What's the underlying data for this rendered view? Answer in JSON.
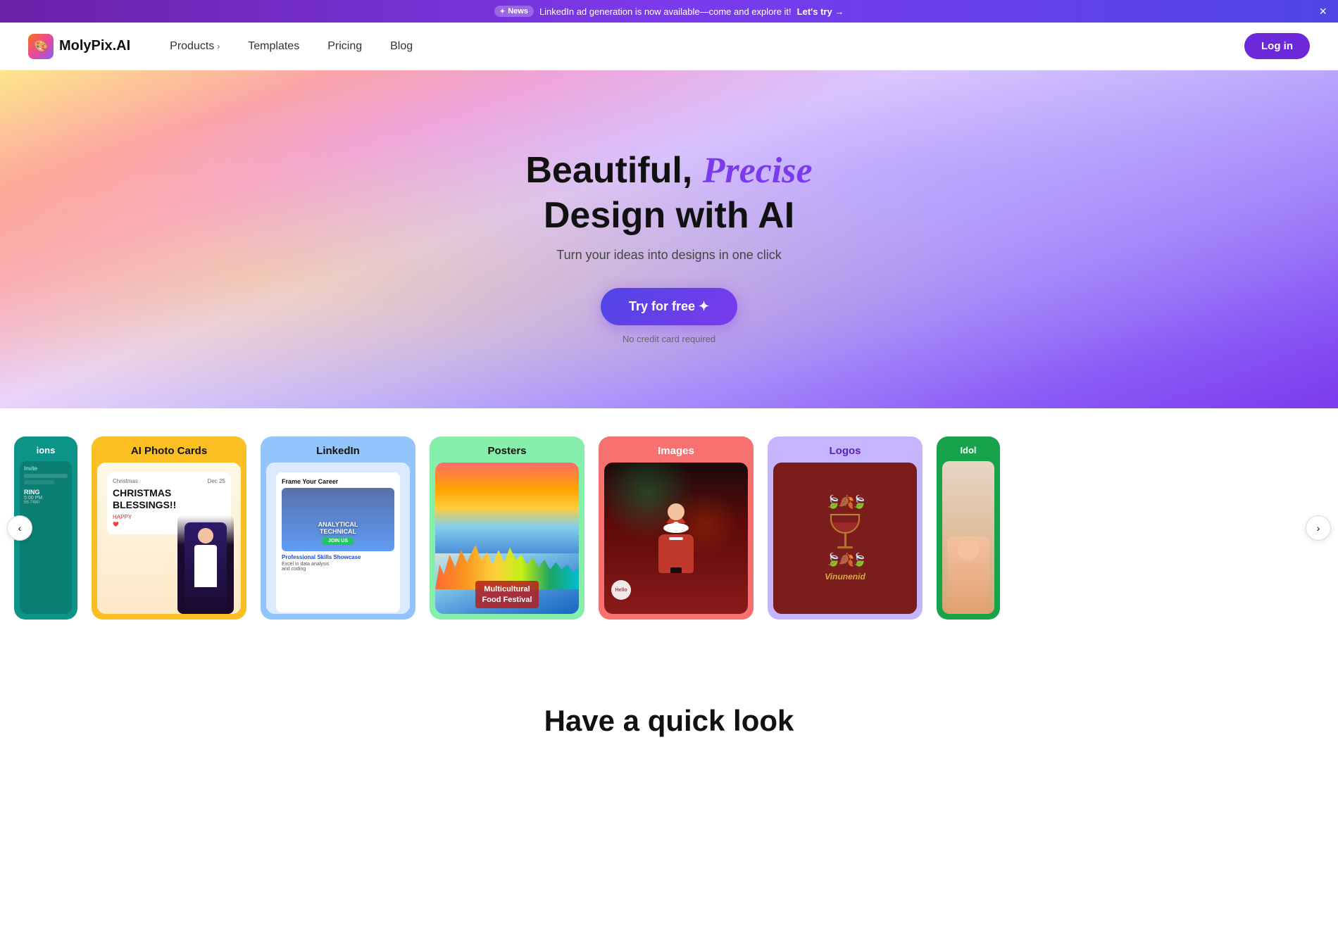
{
  "announcement": {
    "badge": "News",
    "message": "LinkedIn ad generation is now available—come and explore it!",
    "link_text": "Let's try →",
    "close_label": "×"
  },
  "header": {
    "logo_text": "MolyPix.AI",
    "logo_icon": "🎨",
    "nav": [
      {
        "label": "Products",
        "has_arrow": true
      },
      {
        "label": "Templates",
        "has_arrow": false
      },
      {
        "label": "Pricing",
        "has_arrow": false
      },
      {
        "label": "Blog",
        "has_arrow": false
      }
    ],
    "login_label": "Log in"
  },
  "hero": {
    "title_line1_plain": "Beautiful, ",
    "title_line1_italic": "Precise",
    "title_line2": "Design with AI",
    "subtitle": "Turn your ideas into designs in one click",
    "cta_label": "Try for free ✦",
    "no_credit_text": "No credit card required"
  },
  "carousel": {
    "prev_label": "‹",
    "next_label": "›",
    "cards": [
      {
        "id": "invitations",
        "label": "ions",
        "bg": "#0d9488",
        "text_color": "white",
        "partial": true
      },
      {
        "id": "photo-cards",
        "label": "AI Photo Cards",
        "bg": "#fbbf24",
        "text_color": "#111"
      },
      {
        "id": "linkedin",
        "label": "LinkedIn",
        "bg": "#93c5fd",
        "text_color": "#111"
      },
      {
        "id": "posters",
        "label": "Posters",
        "bg": "#86efac",
        "text_color": "#111"
      },
      {
        "id": "images",
        "label": "Images",
        "bg": "#f87171",
        "text_color": "white"
      },
      {
        "id": "logos",
        "label": "Logos",
        "bg": "#c4b5fd",
        "text_color": "#5b21b6"
      },
      {
        "id": "idol",
        "label": "Idol",
        "bg": "#16a34a",
        "text_color": "white",
        "partial": true
      }
    ]
  },
  "quick_look": {
    "title": "Have a quick look"
  }
}
